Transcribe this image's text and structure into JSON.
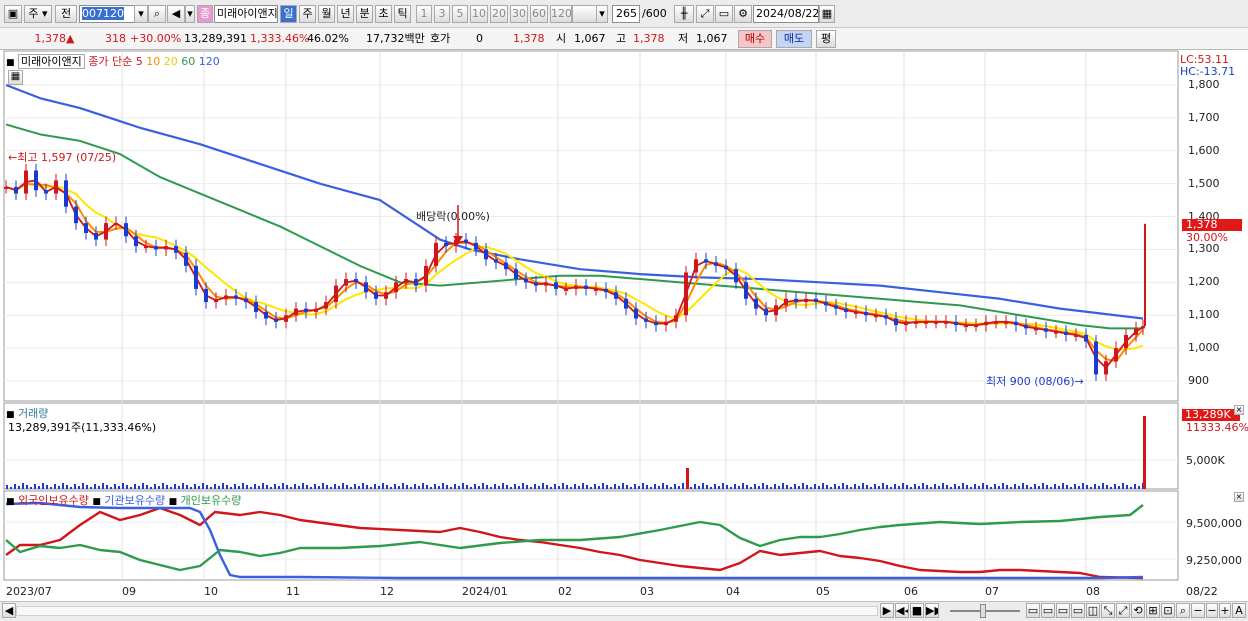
{
  "toolbar": {
    "market_label": "주",
    "side_label": "전",
    "code": "007120",
    "stock_name": "미래아이앤지",
    "badge": "종",
    "periods": [
      "일",
      "주",
      "월",
      "년",
      "분",
      "초",
      "틱"
    ],
    "active_period": "일",
    "intervals": [
      "1",
      "3",
      "5",
      "10",
      "20",
      "30",
      "60",
      "120"
    ],
    "count": "265",
    "count_max": "/600",
    "date": "2024/08/22"
  },
  "quote": {
    "price": "1,378",
    "change": "318",
    "change_pct": "+30.00%",
    "volume": "13,289,391",
    "volume_pct": "1,333.46%",
    "turnover": "46.02%",
    "amount": "17,732백만",
    "hoga_label": "호가",
    "hoga_value": "0",
    "last": "1,378",
    "open_label": "시",
    "open": "1,067",
    "high_label": "고",
    "high": "1,378",
    "low_label": "저",
    "low": "1,067",
    "buy_label": "매수",
    "sell_label": "매도",
    "eval_label": "평"
  },
  "legend": {
    "name": "미래아이앤지",
    "ma_label": "종가 단순",
    "ma5": "5",
    "ma10": "10",
    "ma20": "20",
    "ma60": "60",
    "ma120": "120"
  },
  "right_axis": {
    "lc": "LC:53.11",
    "hc": "HC:-13.71",
    "ticks": [
      "1,800",
      "1,700",
      "1,600",
      "1,500",
      "1,400",
      "1,300",
      "1,200",
      "1,100",
      "1,000",
      "900"
    ],
    "current_price": "1,378",
    "current_pct": "30.00%"
  },
  "annotations": {
    "high": "최고 1,597 (07/25)",
    "low": "최저 900 (08/06)",
    "dividend": "배당락(0.00%)"
  },
  "volume_panel": {
    "title": "거래량",
    "info": "13,289,391주(11,333.46%)",
    "tick_label": "5,000K",
    "box_value": "13,289K",
    "box_pct": "11333.46%"
  },
  "holdings_panel": {
    "foreign": "외국인보유수량",
    "institution": "기관보유수량",
    "individual": "개인보유수량",
    "ticks": [
      "9,500,000",
      "9,250,000"
    ]
  },
  "x_axis": {
    "labels": [
      "2023/07",
      "09",
      "10",
      "11",
      "12",
      "2024/01",
      "02",
      "03",
      "04",
      "05",
      "06",
      "07",
      "08"
    ],
    "end_label": "08/22"
  },
  "colors": {
    "up": "#d0161b",
    "down": "#1b3bd0",
    "ma5": "#d0161b",
    "ma10": "#ff8c00",
    "ma20": "#ffe600",
    "ma60": "#2e9a4e",
    "ma120": "#3a5fe0"
  }
}
